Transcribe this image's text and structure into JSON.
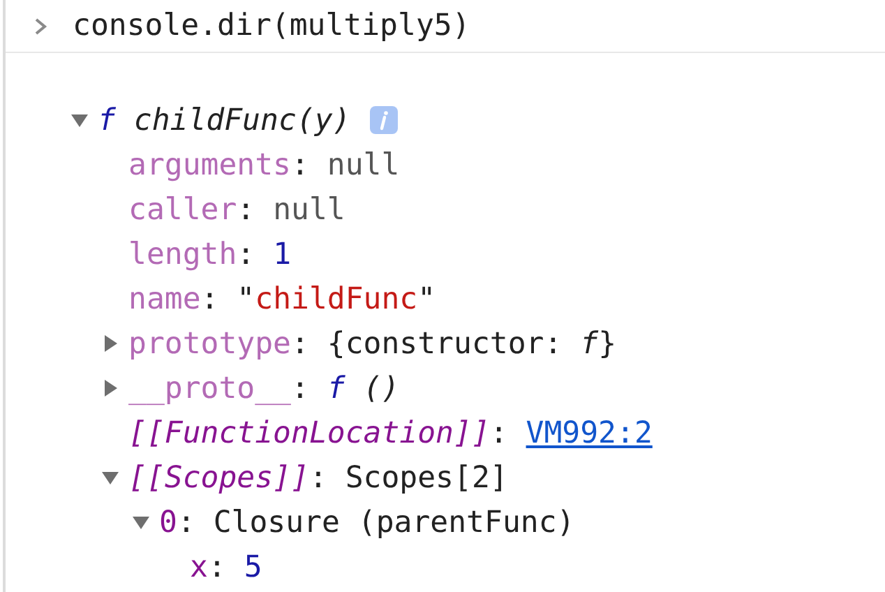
{
  "command": {
    "text": "console.dir(multiply5)"
  },
  "tree": [
    {
      "expanded": true,
      "info_badge": true,
      "tokens": [
        {
          "kind": "fn",
          "text": "f"
        },
        {
          "kind": "title",
          "text": " childFunc(y)"
        }
      ],
      "children": [
        {
          "tokens": [
            {
              "kind": "key",
              "text": "arguments"
            },
            {
              "kind": "plain",
              "text": ": "
            },
            {
              "kind": "null",
              "text": "null"
            }
          ]
        },
        {
          "tokens": [
            {
              "kind": "key",
              "text": "caller"
            },
            {
              "kind": "plain",
              "text": ": "
            },
            {
              "kind": "null",
              "text": "null"
            }
          ]
        },
        {
          "tokens": [
            {
              "kind": "key",
              "text": "length"
            },
            {
              "kind": "plain",
              "text": ": "
            },
            {
              "kind": "number",
              "text": "1"
            }
          ]
        },
        {
          "tokens": [
            {
              "kind": "key",
              "text": "name"
            },
            {
              "kind": "plain",
              "text": ": \""
            },
            {
              "kind": "string",
              "text": "childFunc"
            },
            {
              "kind": "plain",
              "text": "\""
            }
          ]
        },
        {
          "expanded": false,
          "tokens": [
            {
              "kind": "key",
              "text": "prototype"
            },
            {
              "kind": "plain",
              "text": ": {constructor: "
            },
            {
              "kind": "italic",
              "text": "f"
            },
            {
              "kind": "plain",
              "text": "}"
            }
          ]
        },
        {
          "expanded": false,
          "tokens": [
            {
              "kind": "key",
              "text": "__proto__"
            },
            {
              "kind": "plain",
              "text": ": "
            },
            {
              "kind": "fn",
              "text": "f"
            },
            {
              "kind": "italic",
              "text": " ()"
            }
          ]
        },
        {
          "tokens": [
            {
              "kind": "internal",
              "text": "[[FunctionLocation]]"
            },
            {
              "kind": "plain",
              "text": ": "
            },
            {
              "kind": "link",
              "text": "VM992:2"
            }
          ]
        },
        {
          "expanded": true,
          "tokens": [
            {
              "kind": "internal",
              "text": "[[Scopes]]"
            },
            {
              "kind": "plain",
              "text": ": Scopes[2]"
            }
          ],
          "children": [
            {
              "expanded": true,
              "tokens": [
                {
                  "kind": "index",
                  "text": "0"
                },
                {
                  "kind": "plain",
                  "text": ": Closure (parentFunc)"
                }
              ],
              "children": [
                {
                  "tokens": [
                    {
                      "kind": "index",
                      "text": "x"
                    },
                    {
                      "kind": "plain",
                      "text": ": "
                    },
                    {
                      "kind": "number",
                      "text": "5"
                    }
                  ]
                }
              ]
            }
          ]
        }
      ]
    }
  ]
}
